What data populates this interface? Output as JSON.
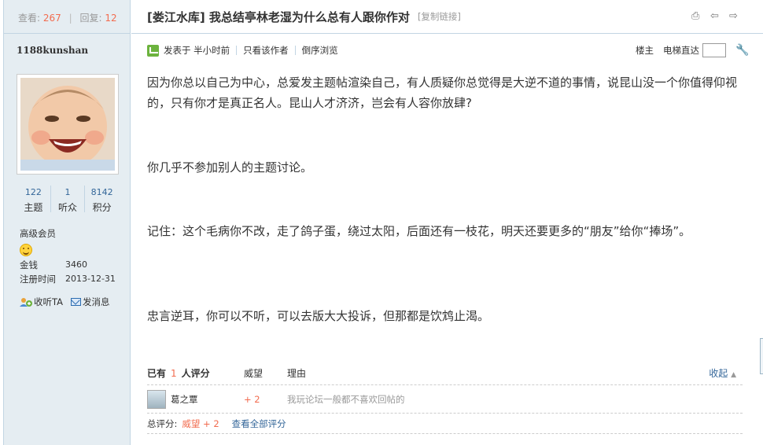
{
  "sidebar": {
    "views_label": "查看:",
    "views_value": "267",
    "replies_label": "回复:",
    "replies_value": "12",
    "username": "1188kunshan",
    "stats": [
      {
        "value": "122",
        "label": "主题"
      },
      {
        "value": "1",
        "label": "听众"
      },
      {
        "value": "8142",
        "label": "积分"
      }
    ],
    "level": "高级会员",
    "money_label": "金钱",
    "money_value": "3460",
    "reg_label": "注册时间",
    "reg_value": "2013-12-31",
    "follow_label": "收听TA",
    "message_label": "发消息"
  },
  "thread": {
    "title": "[娄江水库] 我总结亭林老湿为什么总有人跟你作对",
    "copy_link": "[复制链接]"
  },
  "post_info": {
    "posted_at": "发表于  半小时前",
    "author_only": "只看该作者",
    "reverse": "倒序浏览",
    "floor": "楼主",
    "elevator": "电梯直达"
  },
  "content": {
    "p1": "因为你总以自己为中心，总爱发主题帖渲染自己，有人质疑你总觉得是大逆不道的事情，说昆山没一个你值得仰视的，只有你才是真正名人。昆山人才济济，岂会有人容你放肆?",
    "p2": "你几乎不参加别人的主题讨论。",
    "p3": "记住：这个毛病你不改，走了鸽子蛋，绕过太阳，后面还有一枝花，明天还要更多的“朋友”给你“捧场”。",
    "p4": "忠言逆耳，你可以不听，可以去版大大投诉，但那都是饮鸩止渴。"
  },
  "rating": {
    "header_prefix": "已有",
    "header_count": "1",
    "header_suffix": "人评分",
    "col_points": "威望",
    "col_reason": "理由",
    "collapse": "收起",
    "rows": [
      {
        "user": "葛之覃",
        "points": "+ 2",
        "reason": "我玩论坛一般都不喜欢回帖的"
      }
    ],
    "total_label": "总评分:",
    "total_value": "威望 + 2",
    "view_all": "查看全部评分"
  }
}
